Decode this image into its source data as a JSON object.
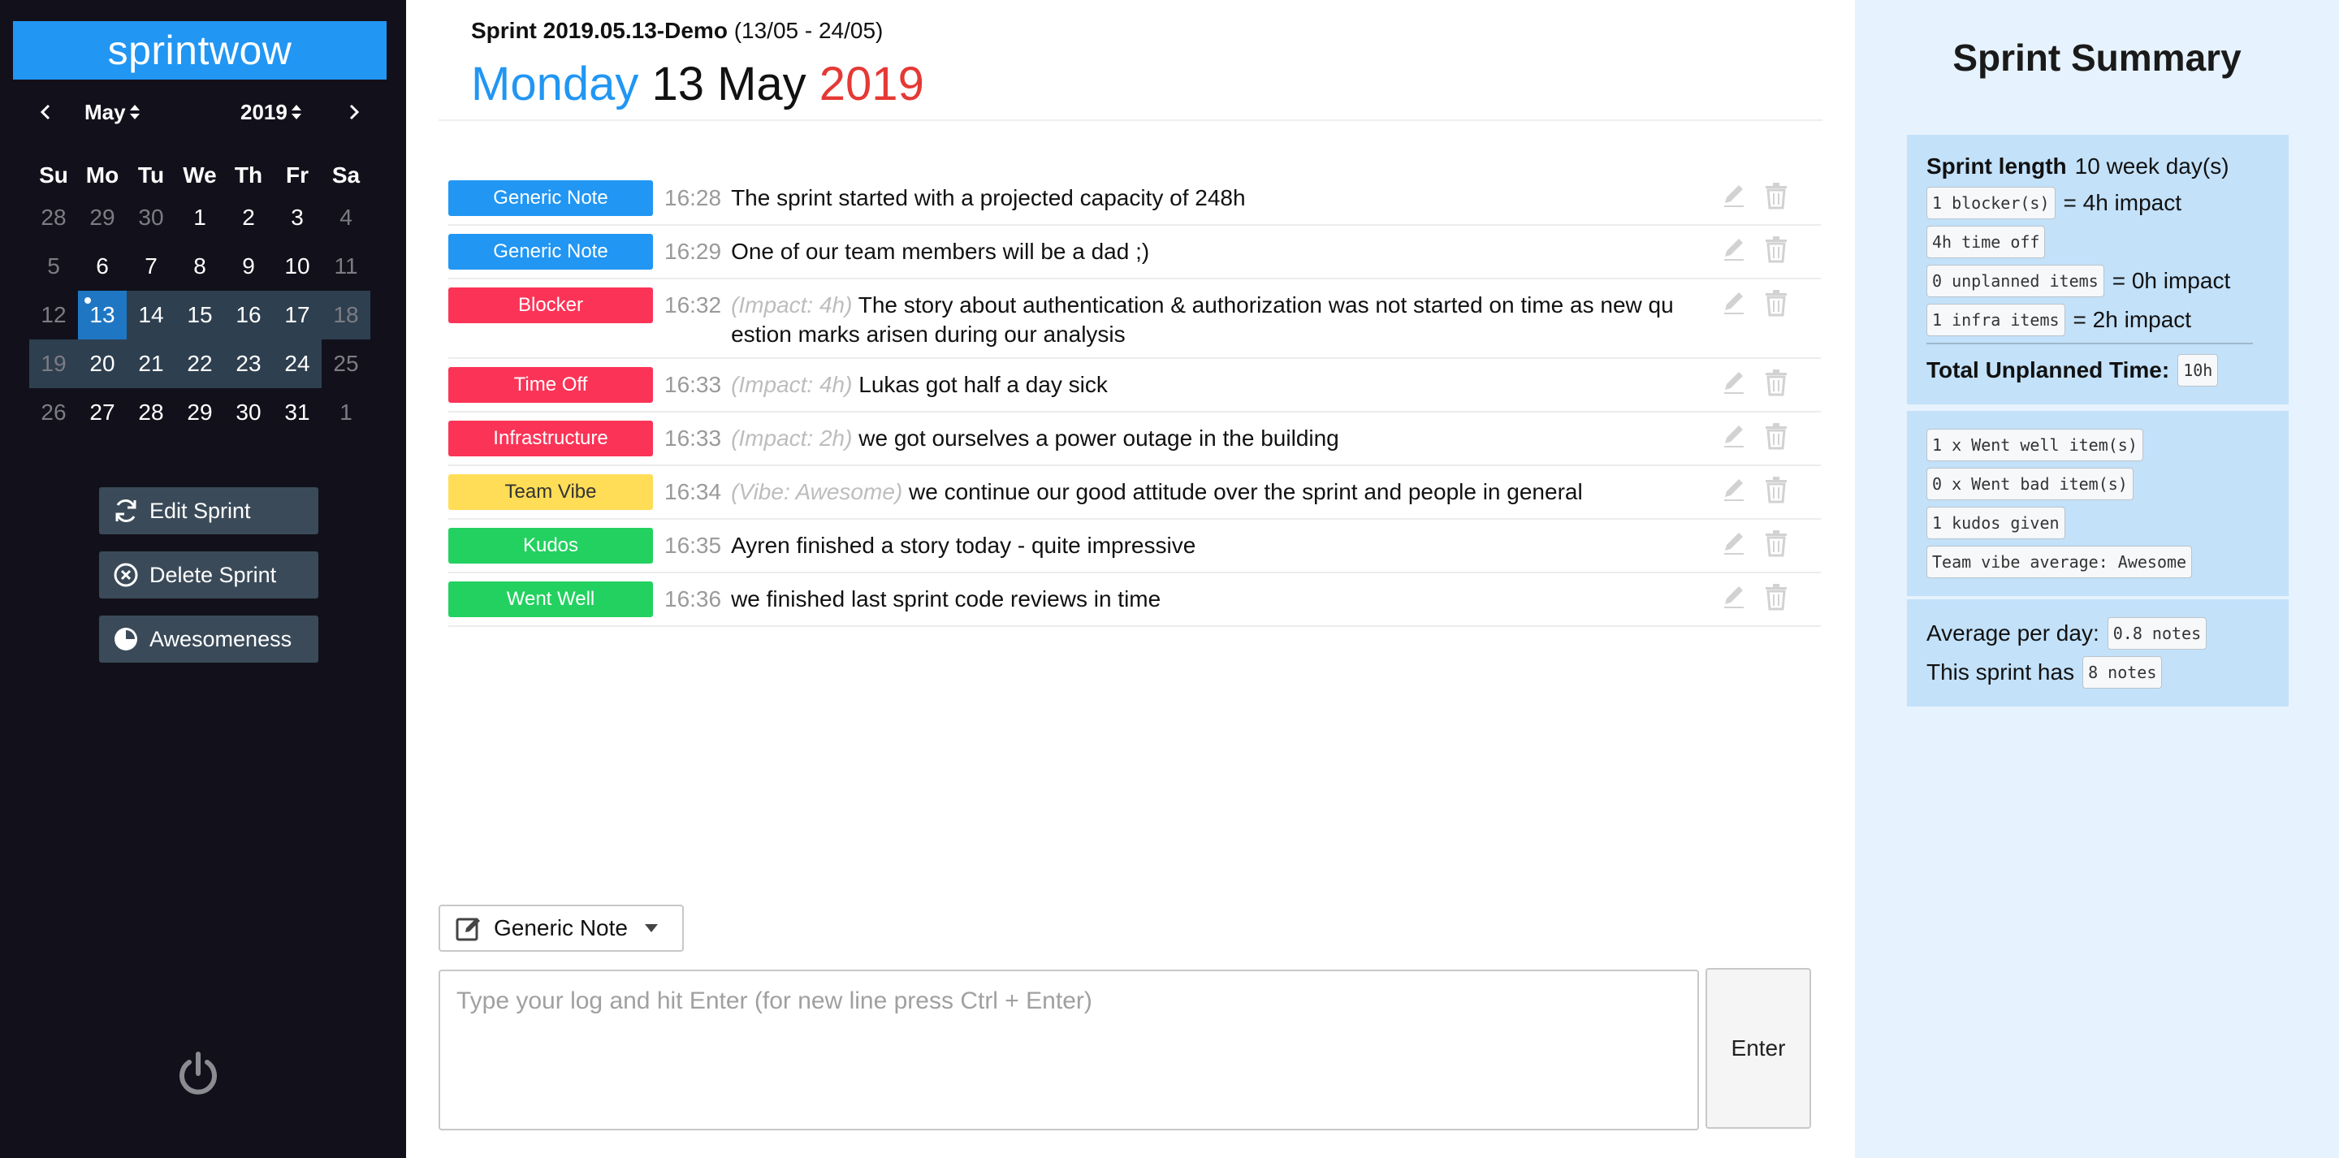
{
  "brand": "sprintwow",
  "calendar": {
    "month": "May",
    "year": "2019",
    "weekdays": [
      "Su",
      "Mo",
      "Tu",
      "We",
      "Th",
      "Fr",
      "Sa"
    ],
    "weeks": [
      [
        "28",
        "29",
        "30",
        "1",
        "2",
        "3",
        "4"
      ],
      [
        "5",
        "6",
        "7",
        "8",
        "9",
        "10",
        "11"
      ],
      [
        "12",
        "13",
        "14",
        "15",
        "16",
        "17",
        "18"
      ],
      [
        "19",
        "20",
        "21",
        "22",
        "23",
        "24",
        "25"
      ],
      [
        "26",
        "27",
        "28",
        "29",
        "30",
        "31",
        "1"
      ]
    ]
  },
  "sidebar_buttons": {
    "edit": "Edit Sprint",
    "delete": "Delete Sprint",
    "awesome": "Awesomeness"
  },
  "header": {
    "sprint_name": "Sprint 2019.05.13-Demo",
    "sprint_range": "(13/05 - 24/05)",
    "day_of_week": "Monday",
    "day_month": "13 May",
    "year": "2019"
  },
  "logs": [
    {
      "tag": "Generic Note",
      "color": "#2196f3",
      "text_color": "#ffffff",
      "time": "16:28",
      "meta": "",
      "text": "The sprint started with a projected capacity of 248h"
    },
    {
      "tag": "Generic Note",
      "color": "#2196f3",
      "text_color": "#ffffff",
      "time": "16:29",
      "meta": "",
      "text": "One of our team members will be a dad ;)"
    },
    {
      "tag": "Blocker",
      "color": "#fb3457",
      "text_color": "#ffffff",
      "time": "16:32",
      "meta": "(Impact: 4h)",
      "text": "The story about authentication & authorization was not started on time as new question marks arisen during our analysis"
    },
    {
      "tag": "Time Off",
      "color": "#fb3457",
      "text_color": "#ffffff",
      "time": "16:33",
      "meta": "(Impact: 4h)",
      "text": "Lukas got half a day sick"
    },
    {
      "tag": "Infrastructure",
      "color": "#fb3457",
      "text_color": "#ffffff",
      "time": "16:33",
      "meta": "(Impact: 2h)",
      "text": "we got ourselves a power outage in the building"
    },
    {
      "tag": "Team Vibe",
      "color": "#ffdd57",
      "text_color": "#333333",
      "time": "16:34",
      "meta": "(Vibe: Awesome)",
      "text": "we continue our good attitude over the sprint and people in general"
    },
    {
      "tag": "Kudos",
      "color": "#23d160",
      "text_color": "#ffffff",
      "time": "16:35",
      "meta": "",
      "text": "Ayren finished a story today - quite impressive"
    },
    {
      "tag": "Went Well",
      "color": "#23d160",
      "text_color": "#ffffff",
      "time": "16:36",
      "meta": "",
      "text": "we finished last sprint code reviews in time"
    }
  ],
  "composer": {
    "type_label": "Generic Note",
    "placeholder": "Type your log and hit Enter (for new line press Ctrl + Enter)",
    "enter_label": "Enter"
  },
  "summary": {
    "title": "Sprint Summary",
    "length_label": "Sprint length",
    "length_value": "10 week day(s)",
    "blockers": "1 blocker(s)",
    "blockers_impact": "= 4h impact",
    "time_off": "4h time off",
    "unplanned": "0 unplanned items",
    "unplanned_impact": "= 0h impact",
    "infra": "1 infra items",
    "infra_impact": "= 2h impact",
    "total_label": "Total Unplanned Time:",
    "total_value": "10h",
    "went_well": "1 x Went well item(s)",
    "went_bad": "0 x Went bad item(s)",
    "kudos": "1 kudos given",
    "vibe": "Team vibe average: Awesome",
    "avg_label": "Average per day:",
    "avg_value": "0.8 notes",
    "count_label": "This sprint has",
    "count_value": "8 notes"
  },
  "colors": {
    "brand": "#2196f3",
    "sidebar_bg": "#12111b",
    "today": "#1f77c4",
    "sprint_range": "#2e3f4f",
    "summary_bg": "#e6f2fd",
    "summary_card": "#c3e1f9"
  }
}
